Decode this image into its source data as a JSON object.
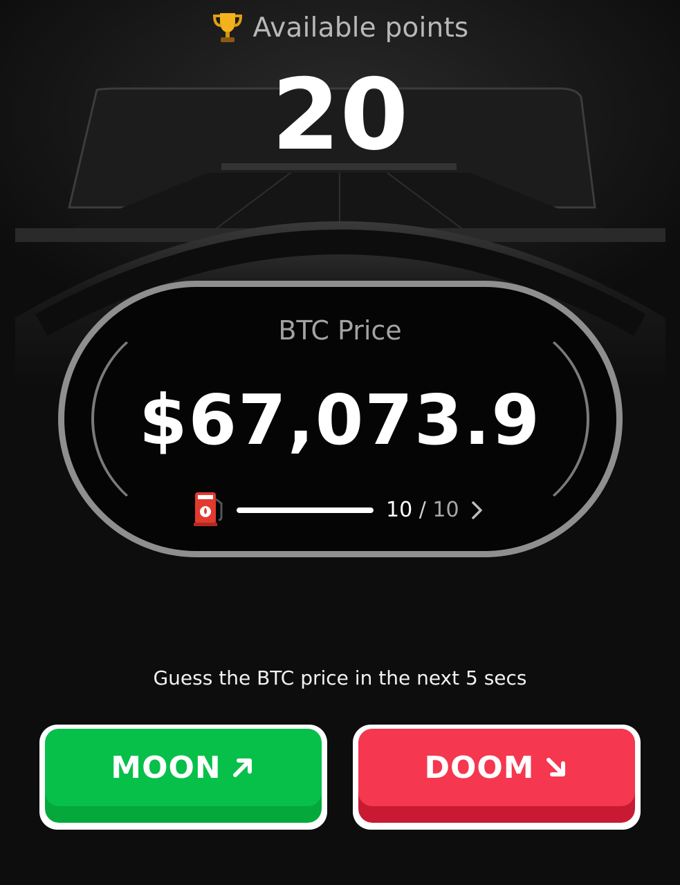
{
  "header": {
    "icon": "trophy-icon",
    "label": "Available points",
    "points": "20"
  },
  "price_panel": {
    "label": "BTC Price",
    "value": "$67,073.9",
    "fuel": {
      "icon": "fuel-pump-icon",
      "current": "10",
      "separator": "/",
      "max": "10",
      "level_fraction": 1.0
    },
    "next_icon": "chevron-right-icon"
  },
  "prompt": "Guess the BTC price in the next 5 secs",
  "buttons": {
    "moon": {
      "label": "MOON",
      "icon": "arrow-up-right-icon",
      "color": "#07c04a"
    },
    "doom": {
      "label": "DOOM",
      "icon": "arrow-down-right-icon",
      "color": "#f5374f"
    }
  },
  "colors": {
    "background": "#0d0d0d",
    "capsule_border": "#8f8f8f",
    "moon_green": "#07c04a",
    "doom_red": "#f5374f"
  }
}
